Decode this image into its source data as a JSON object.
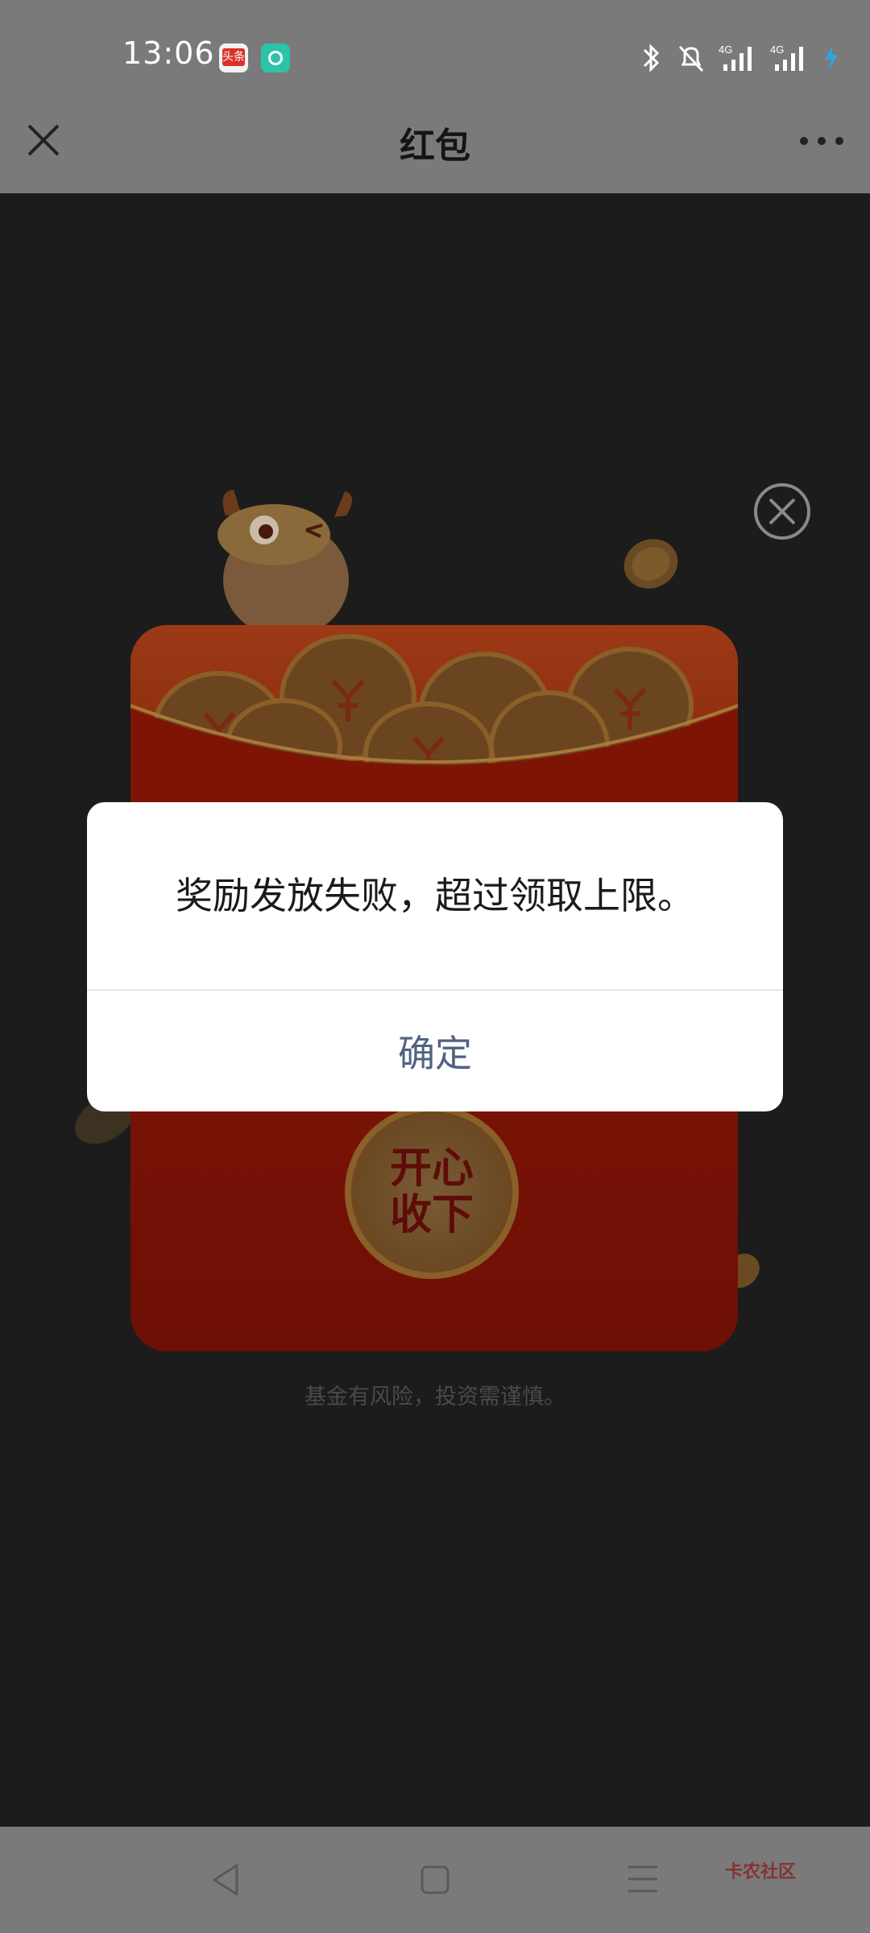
{
  "status_bar": {
    "time": "13:06",
    "apps": [
      {
        "icon": "toutiao-app-icon",
        "label": "头条",
        "color": "#d9322b"
      },
      {
        "icon": "green-app-icon",
        "color": "#2bc4a8"
      }
    ],
    "system_icons": [
      "bluetooth-icon",
      "mute-bell-icon",
      "4g-signal-icon",
      "4g-signal-icon",
      "charging-bolt-icon"
    ],
    "network_labels": [
      "4G",
      "4G"
    ]
  },
  "header": {
    "title": "红包",
    "close_icon": "close-icon",
    "more_icon": "more-dots-icon"
  },
  "promo": {
    "accept_button_line1": "开心",
    "accept_button_line2": "收下",
    "risk_note": "基金有风险，投资需谨慎。",
    "close_icon": "circle-close-icon",
    "colors": {
      "envelope": "#7e1406",
      "coin": "#8a5f28"
    }
  },
  "dialog": {
    "message": "奖励发放失败，超过领取上限。",
    "confirm_label": "确定",
    "confirm_color": "#516282"
  },
  "bottom_nav": {
    "icons": [
      "back-triangle-icon",
      "home-square-icon",
      "recent-menu-icon"
    ],
    "watermark": "卡农社区"
  }
}
